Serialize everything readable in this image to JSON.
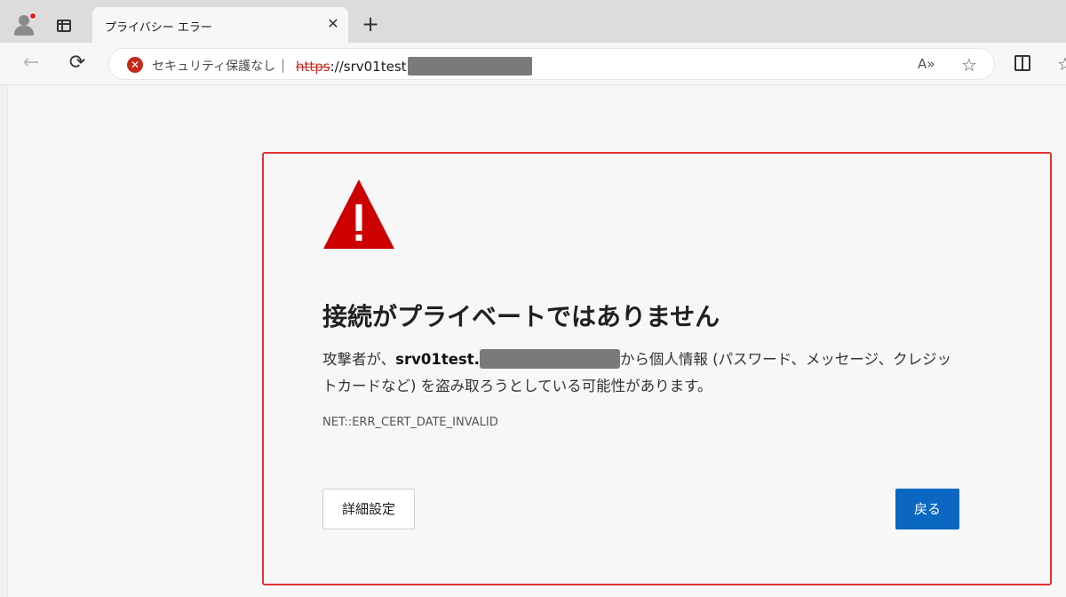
{
  "tab": {
    "title": "プライバシー エラー",
    "close_glyph": "✕",
    "new_tab_glyph": "+"
  },
  "toolbar": {
    "back_glyph": "←",
    "reload_glyph": "⟳",
    "security_icon": "x-circle-icon",
    "security_label": "セキュリティ保護なし",
    "separator": "|",
    "url_scheme": "https",
    "url_rest": "://srv01test",
    "read_aloud_glyph": "A»",
    "favorite_glyph": "☆",
    "favorites_glyph": "☆"
  },
  "error_page": {
    "heading": "接続がプライベートではありません",
    "message_prefix": "攻撃者が、",
    "host": "srv01test.",
    "message_suffix": "から個人情報 (パスワード、メッセージ、クレジットカードなど) を盗み取ろうとしている可能性があります。",
    "error_code": "NET::ERR_CERT_DATE_INVALID",
    "advanced_label": "詳細設定",
    "back_label": "戻る"
  },
  "colors": {
    "warning_red": "#cc0000",
    "primary_blue": "#0a67c2",
    "highlight_border": "#e03232"
  }
}
